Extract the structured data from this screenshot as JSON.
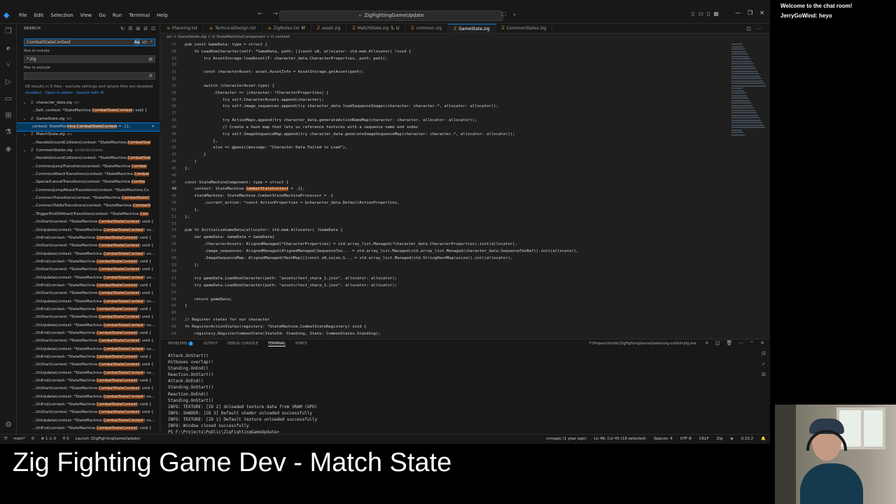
{
  "window": {
    "menu": [
      "File",
      "Edit",
      "Selection",
      "View",
      "Go",
      "Run",
      "Terminal",
      "Help"
    ],
    "command_center": "ZigFightingGameUpdate"
  },
  "search": {
    "header": "SEARCH",
    "query": "CombatStateContext",
    "include_label": "files to include",
    "include_value": "*.zig",
    "exclude_label": "files to exclude",
    "exclude_value": "",
    "info_text": "58 results in 5 files - exclude settings and ignore files are disabled (",
    "enable_link": "enable",
    "info_after": ") -",
    "open_editor_link": "Open in editor",
    "info_dash": "-",
    "search_ai_link": "Search with AI",
    "results": [
      {
        "type": "file",
        "name": "character_data.zig",
        "dir": "src"
      },
      {
        "type": "match",
        "pre": "...Self, context: *StateMachine.",
        "hit": "CombatStateContext",
        "post": ") void {"
      },
      {
        "type": "file",
        "name": "GameState.zig",
        "dir": "src"
      },
      {
        "type": "match",
        "pre": "context: StateMac",
        "hit": "hine.CombatStateContext",
        "post": " = .{},",
        "selected": true
      },
      {
        "type": "file",
        "name": "MatchState.zig",
        "dir": "src"
      },
      {
        "type": "match",
        "pre": "...HandleGroundCollision(context: *StateMachine.",
        "hit": "CombatStat",
        "post": ""
      },
      {
        "type": "file",
        "name": "CommonStates.zig",
        "dir": "src\\ActionStates"
      },
      {
        "type": "match",
        "pre": "...HandleGroundCollision(context: *StateMachine.",
        "hit": "CombatStat",
        "post": ""
      },
      {
        "type": "match",
        "pre": "...CommonJumpTransitions(context: *StateMachine.",
        "hit": "Combat",
        "post": ""
      },
      {
        "type": "match",
        "pre": "...CommonAttackTransitions(context: *StateMachine.",
        "hit": "Combat",
        "post": ""
      },
      {
        "type": "match",
        "pre": "...SpecialCancelTransitions(context: *StateMachine.",
        "hit": "Comba",
        "post": ""
      },
      {
        "type": "match",
        "pre": "...CommonJumpAttackTransitions(context: *StateMachine.Co",
        "hit": "",
        "post": ""
      },
      {
        "type": "match",
        "pre": "...CommonTransitions(context: *StateMachine.",
        "hit": "CombatStateC",
        "post": ""
      },
      {
        "type": "match",
        "pre": "...CommonToIdleTransitions(context: *StateMachine.",
        "hit": "CombatS",
        "post": ""
      },
      {
        "type": "match",
        "pre": "...TriggerEndOfAttackTransition(context: *StateMachine.",
        "hit": "Com",
        "post": ""
      },
      {
        "type": "match",
        "pre": "...OnStart(context: *StateMachine.",
        "hit": "CombatStateContext",
        "post": ") void {"
      },
      {
        "type": "match",
        "pre": "...OnUpdate(context: *StateMachine.",
        "hit": "CombatStateContext",
        "post": ") vo..."
      },
      {
        "type": "match",
        "pre": "...OnEnd(context: *StateMachine.",
        "hit": "CombatStateContext",
        "post": ") void {"
      },
      {
        "type": "match",
        "pre": "...OnStart(context: *StateMachine.",
        "hit": "CombatStateContext",
        "post": ") void {"
      },
      {
        "type": "match",
        "pre": "...OnUpdate(context: *StateMachine.",
        "hit": "CombatStateContext",
        "post": ") vo..."
      },
      {
        "type": "match",
        "pre": "...OnEnd(context: *StateMachine.",
        "hit": "CombatStateContext",
        "post": ") void {"
      },
      {
        "type": "match",
        "pre": "...OnStart(context: *StateMachine.",
        "hit": "CombatStateContext",
        "post": ") void {"
      },
      {
        "type": "match",
        "pre": "...OnUpdate(context: *StateMachine.",
        "hit": "CombatStateContext",
        "post": ") vo..."
      },
      {
        "type": "match",
        "pre": "...OnEnd(context: *StateMachine.",
        "hit": "CombatStateContext",
        "post": ") void {"
      },
      {
        "type": "match",
        "pre": "...OnStart(context: *StateMachine.",
        "hit": "CombatStateContext",
        "post": ") void {"
      },
      {
        "type": "match",
        "pre": "...OnUpdate(context: *StateMachine.",
        "hit": "CombatStateContext",
        "post": ") vo..."
      },
      {
        "type": "match",
        "pre": "...OnEnd(context: *StateMachine.",
        "hit": "CombatStateContext",
        "post": ") void {"
      },
      {
        "type": "match",
        "pre": "...OnStart(context: *StateMachine.",
        "hit": "CombatStateContext",
        "post": ") void {"
      },
      {
        "type": "match",
        "pre": "...OnUpdate(context: *StateMachine.",
        "hit": "CombatStateContext",
        "post": ") vo..."
      },
      {
        "type": "match",
        "pre": "...OnEnd(context: *StateMachine.",
        "hit": "CombatStateContext",
        "post": ") void {"
      },
      {
        "type": "match",
        "pre": "...OnStart(context: *StateMachine.",
        "hit": "CombatStateContext",
        "post": ") void {"
      },
      {
        "type": "match",
        "pre": "...OnUpdate(context: *StateMachine.",
        "hit": "CombatStateContext",
        "post": ") vo..."
      },
      {
        "type": "match",
        "pre": "...OnEnd(context: *StateMachine.",
        "hit": "CombatStateContext",
        "post": ") void {"
      },
      {
        "type": "match",
        "pre": "...OnStart(context: *StateMachine.",
        "hit": "CombatStateContext",
        "post": ") void {"
      },
      {
        "type": "match",
        "pre": "...OnUpdate(context: *StateMachine.",
        "hit": "CombatStateContext",
        "post": ") vo..."
      },
      {
        "type": "match",
        "pre": "...OnEnd(context: *StateMachine.",
        "hit": "CombatStateContext",
        "post": ") void {"
      },
      {
        "type": "match",
        "pre": "...OnStart(context: *StateMachine.",
        "hit": "CombatStateContext",
        "post": ") void {"
      },
      {
        "type": "match",
        "pre": "...OnUpdate(context: *StateMachine.",
        "hit": "CombatStateContext",
        "post": ") vo..."
      },
      {
        "type": "match",
        "pre": "...OnEnd(context: *StateMachine.",
        "hit": "CombatStateContext",
        "post": ") void {"
      },
      {
        "type": "match",
        "pre": "...OnStart(context: *StateMachine.",
        "hit": "CombatStateContext",
        "post": ") void {"
      },
      {
        "type": "match",
        "pre": "...OnUpdate(context: *StateMachine.",
        "hit": "CombatStateContext",
        "post": ") vo..."
      },
      {
        "type": "match",
        "pre": "...OnEnd(context: *StateMachine.",
        "hit": "CombatStateContext",
        "post": ") void {"
      },
      {
        "type": "match",
        "pre": "...OnStart(context: *StateMachine.",
        "hit": "CombatStateContext",
        "post": ") void {"
      },
      {
        "type": "match",
        "pre": "...OnUpdate(context: *StateMachine.",
        "hit": "CombatStateContext",
        "post": ") vo..."
      },
      {
        "type": "match",
        "pre": "...OnEnd(context: *StateMachine.",
        "hit": "CombatStateContext",
        "post": ") void {"
      }
    ]
  },
  "editor": {
    "tabs": [
      {
        "name": "Planning.txt",
        "active": false,
        "mod": ""
      },
      {
        "name": "TechnicalDesign.txt",
        "active": false,
        "mod": ""
      },
      {
        "name": "ZigNotes.txt",
        "active": false,
        "mod": "M"
      },
      {
        "name": "asset.zig",
        "active": false,
        "mod": ""
      },
      {
        "name": "MatchState.zig",
        "active": false,
        "mod": "5, U"
      },
      {
        "name": "common.zig",
        "active": false,
        "mod": ""
      },
      {
        "name": "GameState.zig",
        "active": true,
        "mod": ""
      },
      {
        "name": "CommonStates.zig",
        "active": false,
        "mod": ""
      }
    ],
    "breadcrumb": "src > GameState.zig > ⊡ StateMachineComponent > ⊡ context",
    "lines": [
      {
        "n": "27",
        "text": "pub const GameData: type = struct {"
      },
      {
        "n": "28",
        "text": "    fn LoadOneCharacter(self: *GameData, path: []const u8, allocator: std.mem.Allocator) !void {"
      },
      {
        "n": "29",
        "text": "        try AssetStorage.loadAsset(T: character_data.CharacterProperties, path: path);"
      },
      {
        "n": "30",
        "text": ""
      },
      {
        "n": "31",
        "text": "        const characterAsset: asset.AssetInfo = AssetStorage.getAsset(path);"
      },
      {
        "n": "32",
        "text": ""
      },
      {
        "n": "33",
        "text": "        switch (characterAsset.type) {"
      },
      {
        "n": "34",
        "text": "            .Character => |character: *CharacterProperties| {"
      },
      {
        "n": "35",
        "text": "                try self.CharacterAssets.append(character);"
      },
      {
        "n": "36",
        "text": "                try self.image_sequences.append(try character_data.loadSequenceImages(character: character.*, allocator: allocator));"
      },
      {
        "n": "37",
        "text": ""
      },
      {
        "n": "38",
        "text": "                try ActionMaps.append(try character_data.generateActionNameMap(character: character, allocator: allocator));"
      },
      {
        "n": "39",
        "text": "                // Create a hash map that lets us reference textures with a sequence name and index"
      },
      {
        "n": "40",
        "text": "                try self.ImageSequenceMap.append(try character_data.generateImageSequenceMap(character: character.*, allocator: allocator));"
      },
      {
        "n": "41",
        "text": "            },"
      },
      {
        "n": "42",
        "text": "            else => @panic(message: \"Character Data Failed to Load\"),"
      },
      {
        "n": "43",
        "text": "        }"
      },
      {
        "n": "44",
        "text": "    }"
      },
      {
        "n": "45",
        "text": "};"
      },
      {
        "n": "46",
        "text": ""
      },
      {
        "n": "47",
        "text": "const StateMachineComponent: type = struct {"
      },
      {
        "n": "48",
        "text": "    context: StateMachine.CombatStateContext = .{},"
      },
      {
        "n": "49",
        "text": "    stateMachine: StateMachine.CombatStateMachineProcessor = .{"
      },
      {
        "n": "50",
        "text": "        .current_action: *const ActionProperties = &character_data.DefaultActionProperties,"
      },
      {
        "n": "51",
        "text": "    },"
      },
      {
        "n": "52",
        "text": "};"
      },
      {
        "n": "53",
        "text": ""
      },
      {
        "n": "54",
        "text": "pub fn InitializeGameData(allocator: std.mem.Allocator) !GameData {"
      },
      {
        "n": "55",
        "text": "    var gameData: GameData = GameData{"
      },
      {
        "n": "56",
        "text": "        .CharacterAssets: AlignedManaged(*CharacterProperties) = std.array_list.Managed(*character_data.CharacterProperties).init(allocator),"
      },
      {
        "n": "57",
        "text": "        .image_sequences: AlignedManaged(AlignedManaged(SequenceTex... = std.array_list.Managed(std.array_list.Managed(character_data.SequenceTexRef)).init(allocator),"
      },
      {
        "n": "58",
        "text": "        .ImageSequenceMap: AlignedManaged(HashMap([]const u8,usize,S... = std.array_list.Managed(std.StringHashMap(usize)).init(allocator),"
      },
      {
        "n": "59",
        "text": "    };"
      },
      {
        "n": "60",
        "text": ""
      },
      {
        "n": "61",
        "text": "    try gameData.LoadOneCharacter(path: \"assets/test_chara_1.json\", allocator: allocator);"
      },
      {
        "n": "62",
        "text": "    try gameData.LoadOneCharacter(path: \"assets/test_chara_1.json\", allocator: allocator);"
      },
      {
        "n": "63",
        "text": ""
      },
      {
        "n": "64",
        "text": "    return gameData;"
      },
      {
        "n": "65",
        "text": "}"
      },
      {
        "n": "66",
        "text": ""
      },
      {
        "n": "67",
        "text": "// Register states for our character"
      },
      {
        "n": "68",
        "text": "fn RegisterActionStates(registery: *StateMachine.CombatStateRegistery) void {"
      },
      {
        "n": "69",
        "text": "    registery.RegisterCommonState(StateId: Standing, State: CommonStates.Standing);"
      }
    ]
  },
  "panel": {
    "tabs": [
      "PROBLEMS",
      "OUTPUT",
      "DEBUG CONSOLE",
      "TERMINAL",
      "PORTS"
    ],
    "problems_count": "1",
    "terminal_title": "F:\\Projects\\Public\\ZigFightingGameUpdate\\zig-out\\bin\\zfg.exe",
    "terminal_lines": [
      "Attack.OnStart()",
      "Hitboxes overlap!!",
      "Standing.OnEnd()",
      "Reaction.OnStart()",
      "Attack.OnEnd()",
      "Standing.OnStart()",
      "Reaction.OnEnd()",
      "Standing.OnStart()",
      "INFO: TEXTURE: [ID 2] Unloaded texture data from VRAM (GPU)",
      "INFO: SHADER: [ID 3] Default shader unloaded successfully",
      "INFO: TEXTURE: [ID 1] Default texture unloaded successfully",
      "INFO: Window closed successfully",
      "PS F:\\Projects\\Public\\ZigFightingGameUpdate>"
    ]
  },
  "status": {
    "branch": "main*",
    "sync": "⟳",
    "errors": "⊗ 1 ⚠ 0",
    "ports": "⚲ 0",
    "launch": "Launch (ZigFightingGameUpdate)",
    "blame": "rcmagic (1 year ago)",
    "position": "Ln 48, Col 45 (18 selected)",
    "spaces": "Spaces: 4",
    "encoding": "UTF-8",
    "eol": "CRLF",
    "language": "Zig",
    "version": "0.15.2"
  },
  "chat": {
    "welcome": "Welcome to the chat room!",
    "message": "JerryGoWind: heyo"
  },
  "stream_title": "Zig Fighting Game Dev - Match State",
  "colors": {
    "accent": "#0078d4",
    "match_highlight": "#ea5c00",
    "editor_bg": "#1f1f1f"
  }
}
